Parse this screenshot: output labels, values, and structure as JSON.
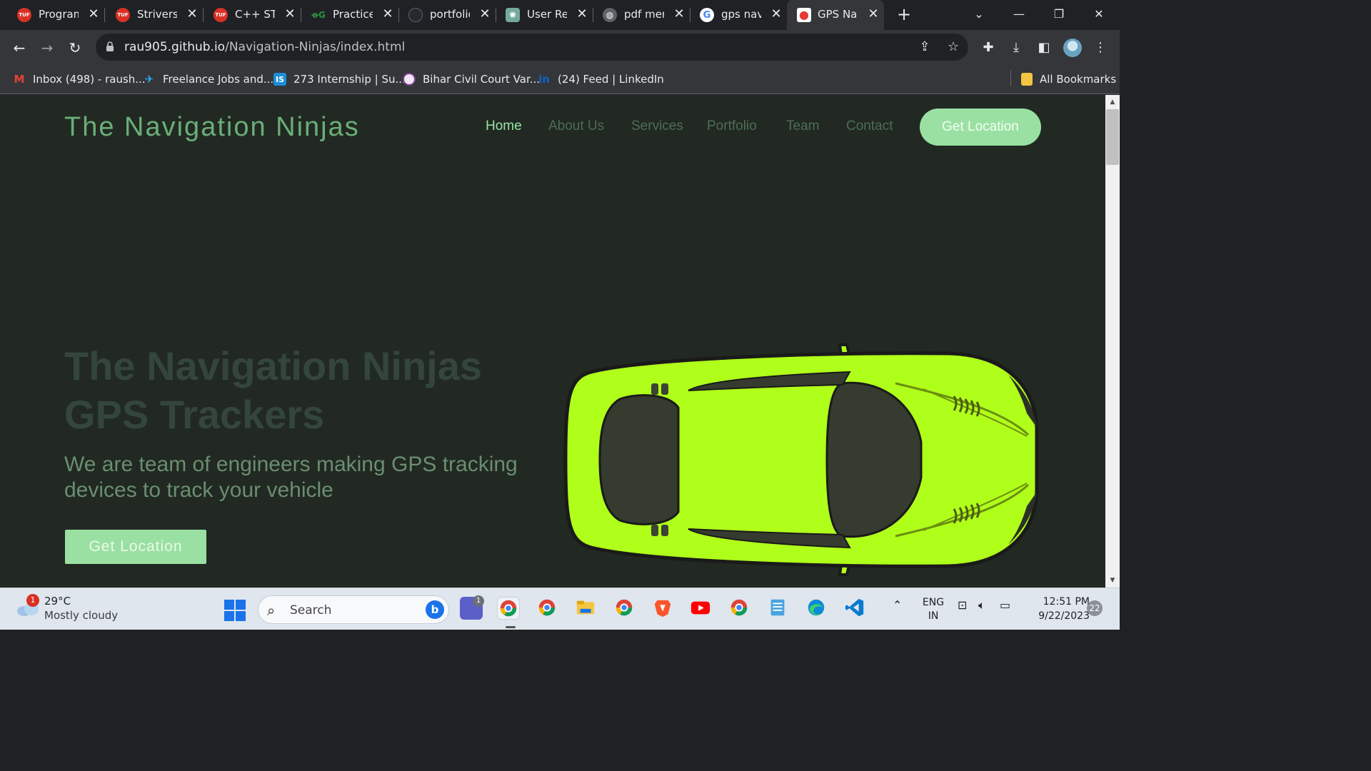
{
  "browser": {
    "tabs": [
      {
        "title": "Program",
        "icon": "tuf-icon",
        "color": "#d93025"
      },
      {
        "title": "Strivers A",
        "icon": "tuf-icon",
        "color": "#d93025"
      },
      {
        "title": "C++ STL",
        "icon": "tuf-icon",
        "color": "#d93025"
      },
      {
        "title": "Practice",
        "icon": "gfg-icon",
        "color": "#2f8d46"
      },
      {
        "title": "portfolio",
        "icon": "github-icon",
        "color": "#24292e"
      },
      {
        "title": "User Req",
        "icon": "chatgpt-icon",
        "color": "#74aa9c"
      },
      {
        "title": "pdf merz",
        "icon": "globe-icon",
        "color": "#5f6368"
      },
      {
        "title": "gps navig",
        "icon": "google-icon",
        "color": "#ffffff"
      },
      {
        "title": "GPS Nav",
        "icon": "map-pin-icon",
        "color": "#e53935"
      }
    ],
    "tab_icon_texts": {
      "tuf": "TUF",
      "gfg": "ꝋG"
    },
    "active_tab_index": 8,
    "url_host": "rau905.github.io",
    "url_path": "/Navigation-Ninjas/index.html",
    "bookmarks": [
      {
        "label": "Inbox (498) - raush...",
        "icon": "gmail-icon"
      },
      {
        "label": "Freelance Jobs and...",
        "icon": "freelancer-icon"
      },
      {
        "label": "273 Internship | Su...",
        "icon": "internshala-icon"
      },
      {
        "label": "Bihar Civil Court Var...",
        "icon": "court-icon"
      },
      {
        "label": "(24) Feed | LinkedIn",
        "icon": "linkedin-icon"
      }
    ],
    "all_bookmarks_label": "All Bookmarks"
  },
  "site": {
    "logo": "The Navigation Ninjas",
    "nav": [
      "Home",
      "About Us",
      "Services",
      "Portfolio",
      "Team",
      "Contact"
    ],
    "active_nav": "Home",
    "nav_cta": "Get Location",
    "hero_title_line1": "The Navigation Ninjas",
    "hero_title_line2": "GPS Trackers",
    "hero_subtitle": "We are team of engineers making GPS tracking devices to track your vehicle",
    "hero_cta": "Get Location",
    "car_color": "#b0ff1a",
    "colors": {
      "background": "#212922",
      "accent": "#9ae0a2",
      "logo": "#6aae78",
      "nav_inactive": "#4e6d54",
      "hero_title": "#34463c"
    }
  },
  "taskbar": {
    "weather_temp": "29°C",
    "weather_desc": "Mostly cloudy",
    "weather_badge": "1",
    "search_placeholder": "Search",
    "bing_label": "b",
    "teams_badge": "1",
    "lang_line1": "ENG",
    "lang_line2": "IN",
    "time": "12:51 PM",
    "date": "9/22/2023",
    "notifications": "22"
  }
}
